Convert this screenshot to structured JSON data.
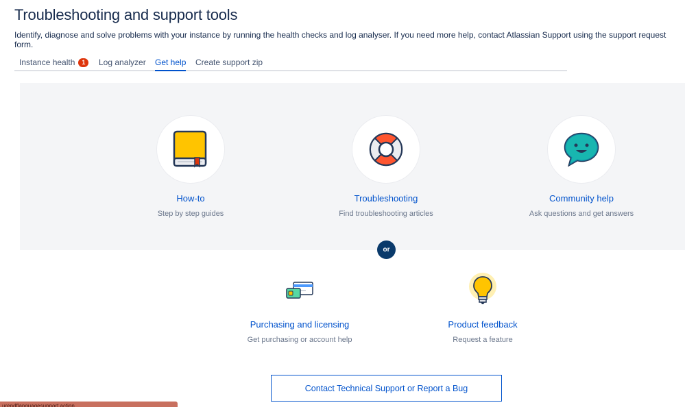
{
  "page": {
    "title": "Troubleshooting and support tools",
    "description": "Identify, diagnose and solve problems with your instance by running the health checks and log analyser. If you need more help, contact Atlassian Support using the support request form."
  },
  "tabs": [
    {
      "label": "Instance health",
      "badge": "1",
      "active": false
    },
    {
      "label": "Log analyzer",
      "active": false
    },
    {
      "label": "Get help",
      "active": true
    },
    {
      "label": "Create support zip",
      "active": false
    }
  ],
  "help_cards": [
    {
      "title": "How-to",
      "subtitle": "Step by step guides",
      "icon": "book-icon"
    },
    {
      "title": "Troubleshooting",
      "subtitle": "Find troubleshooting articles",
      "icon": "lifebuoy-icon"
    },
    {
      "title": "Community help",
      "subtitle": "Ask questions and get answers",
      "icon": "chat-bubble-icon"
    }
  ],
  "or_label": "or",
  "secondary_cards": [
    {
      "title": "Purchasing and licensing",
      "subtitle": "Get purchasing or account help",
      "icon": "payment-cards-icon"
    },
    {
      "title": "Product feedback",
      "subtitle": "Request a feature",
      "icon": "lightbulb-icon"
    }
  ],
  "contact_button": "Contact Technical Support or Report a Bug",
  "status_bar_url": "urendflanguagesupport.action",
  "colors": {
    "link": "#0052cc",
    "badge": "#de350b",
    "panel_bg": "#f4f5f7",
    "or_badge": "#0a3a6b"
  }
}
